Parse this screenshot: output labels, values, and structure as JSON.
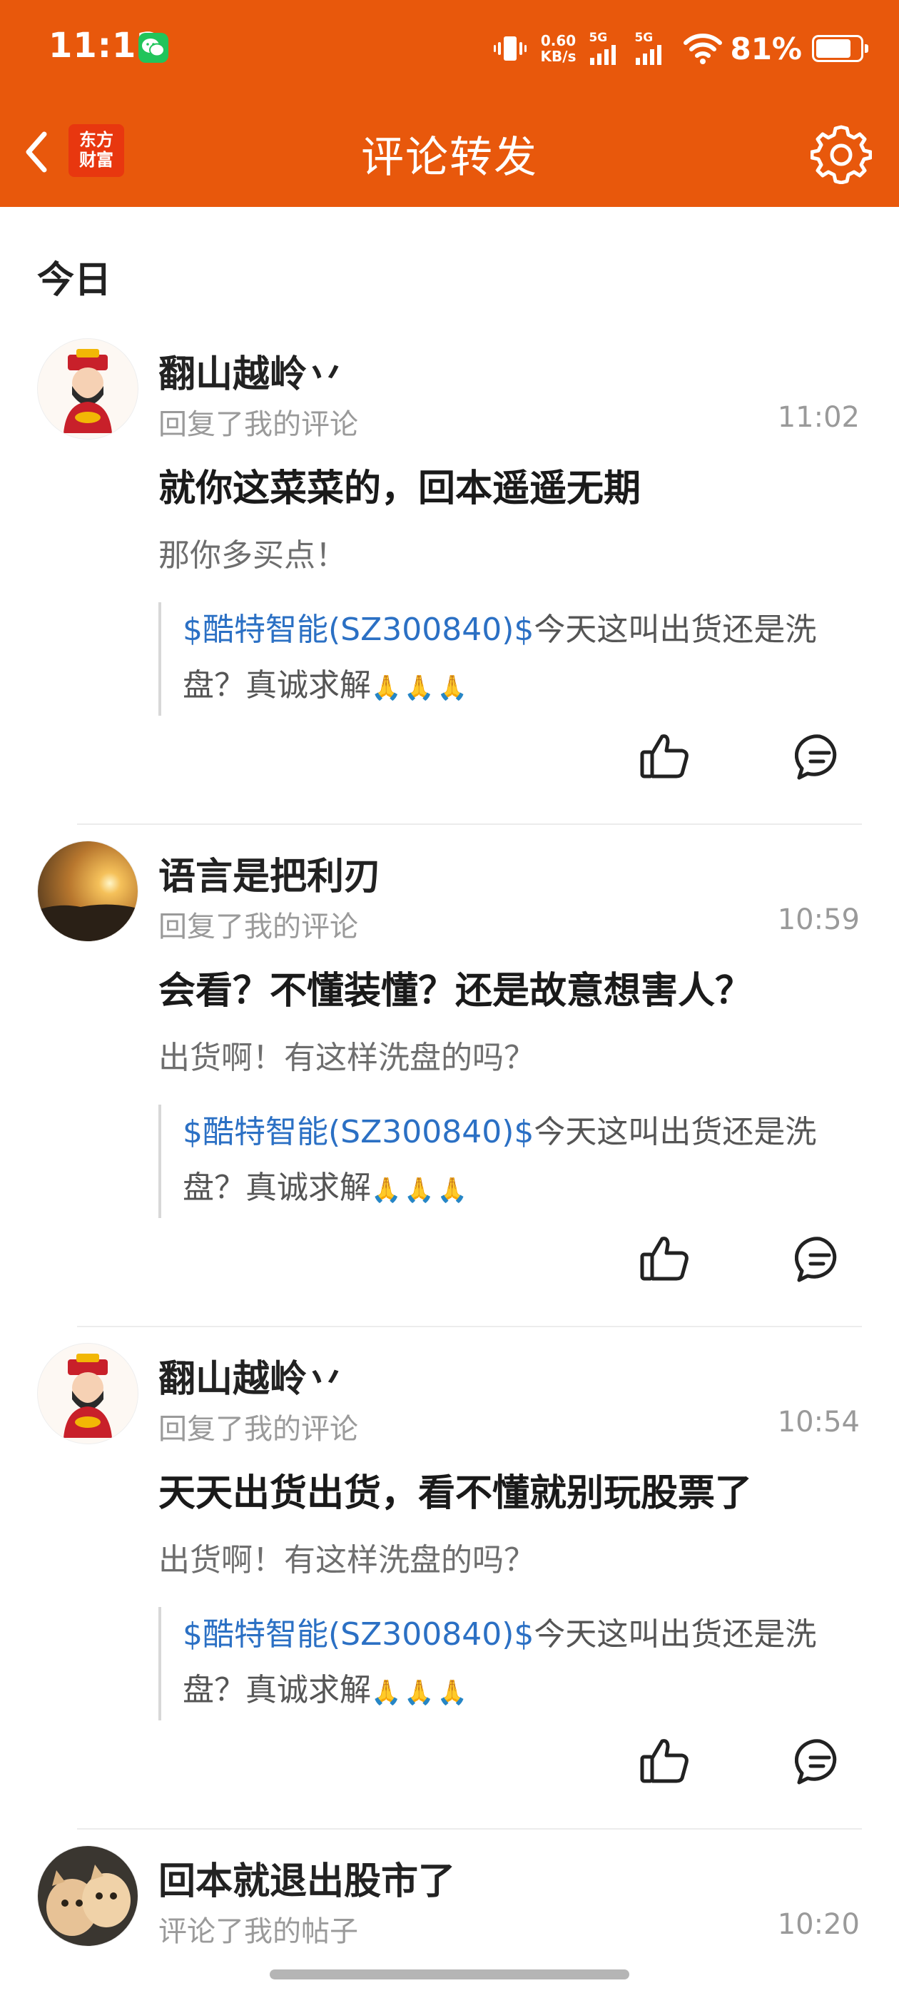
{
  "status": {
    "time": "11:12",
    "speed_value": "0.60",
    "speed_unit": "KB/s",
    "sim1": "5G",
    "sim2": "5G",
    "battery": "81%"
  },
  "nav": {
    "logo_line1": "东方",
    "logo_line2": "财富",
    "title": "评论转发"
  },
  "section": "今日",
  "items": [
    {
      "user": "翻山越岭丷",
      "action": "回复了我的评论",
      "time": "11:02",
      "reply": "就你这菜菜的，回本遥遥无期",
      "original": "那你多买点！",
      "quote_stock": "$酷特智能(SZ300840)$",
      "quote_text": "今天这叫出货还是洗盘？真诚求解",
      "emoji": "🙏🙏🙏"
    },
    {
      "user": "语言是把利刃",
      "action": "回复了我的评论",
      "time": "10:59",
      "reply": "会看？不懂装懂？还是故意想害人？",
      "original": "出货啊！有这样洗盘的吗？",
      "quote_stock": "$酷特智能(SZ300840)$",
      "quote_text": "今天这叫出货还是洗盘？真诚求解",
      "emoji": "🙏🙏🙏"
    },
    {
      "user": "翻山越岭丷",
      "action": "回复了我的评论",
      "time": "10:54",
      "reply": "天天出货出货，看不懂就别玩股票了",
      "original": "出货啊！有这样洗盘的吗？",
      "quote_stock": "$酷特智能(SZ300840)$",
      "quote_text": "今天这叫出货还是洗盘？真诚求解",
      "emoji": "🙏🙏🙏"
    },
    {
      "user": "回本就退出股市了",
      "action": "评论了我的帖子",
      "time": "10:20"
    }
  ],
  "icons": {
    "back": "chevron-left-icon",
    "settings": "gear-icon",
    "like": "thumbs-up-icon",
    "comment": "comment-bubble-icon"
  },
  "colors": {
    "brand": "#e8580c",
    "link": "#2b70c4",
    "logo_red": "#e8370f"
  }
}
